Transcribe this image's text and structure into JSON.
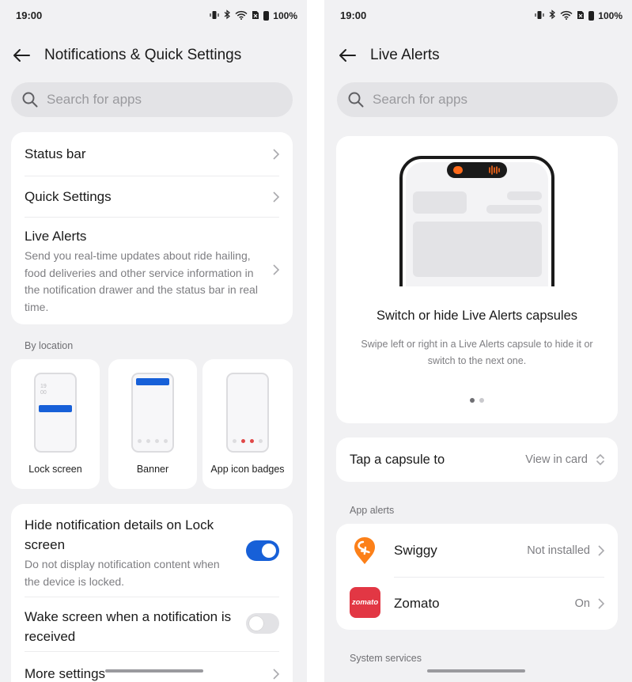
{
  "status": {
    "time": "19:00",
    "battery": "100%"
  },
  "left": {
    "title": "Notifications & Quick Settings",
    "search_placeholder": "Search for apps",
    "menu": {
      "status_bar": "Status bar",
      "quick_settings": "Quick Settings",
      "live_alerts_title": "Live Alerts",
      "live_alerts_desc": "Send you real-time updates about ride hailing, food deliveries and other service information in the notification drawer and the status bar in real time."
    },
    "by_location_label": "By location",
    "locations": [
      "Lock screen",
      "Banner",
      "App icon badges"
    ],
    "lock_preview_text": "19\n00",
    "hide_details": {
      "title": "Hide notification details on Lock screen",
      "desc": "Do not display notification content when the device is locked.",
      "enabled": true
    },
    "wake_screen": {
      "title": "Wake screen when a notification is received",
      "enabled": false
    },
    "more_settings": "More settings"
  },
  "right": {
    "title": "Live Alerts",
    "search_placeholder": "Search for apps",
    "promo": {
      "heading": "Switch or hide Live Alerts capsules",
      "desc": "Swipe left or right in a Live Alerts capsule to hide it or switch to the next one.",
      "pages": 2,
      "active_page": 1
    },
    "tap_capsule": {
      "label": "Tap a capsule to",
      "value": "View in card"
    },
    "app_alerts_label": "App alerts",
    "apps": [
      {
        "name": "Swiggy",
        "status": "Not installed",
        "icon": "swiggy-logo"
      },
      {
        "name": "Zomato",
        "status": "On",
        "icon": "zomato-logo",
        "logo_text": "zomato"
      }
    ],
    "system_services_label": "System services"
  },
  "colors": {
    "accent": "#1760d8",
    "swiggy": "#fc8019",
    "zomato": "#e23744"
  }
}
